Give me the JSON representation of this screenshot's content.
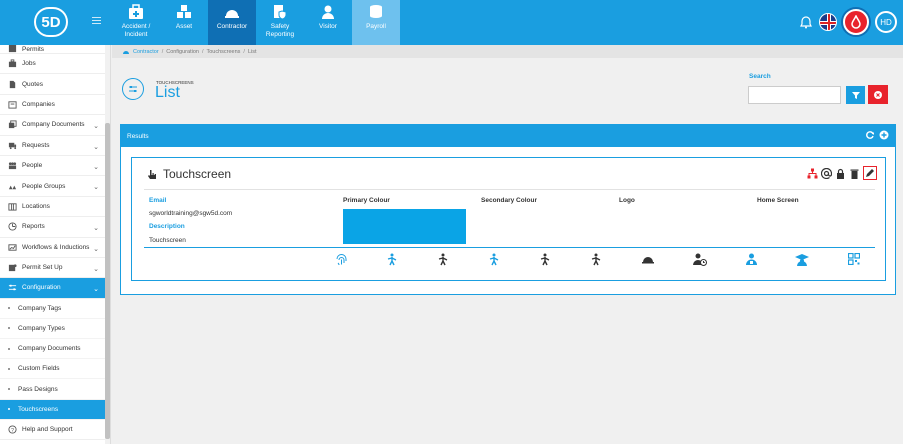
{
  "logo": {
    "text": "5D"
  },
  "modules": [
    {
      "label": "Accident / Incident",
      "icon": "first-aid-kit-icon"
    },
    {
      "label": "Asset",
      "icon": "boxes-icon"
    },
    {
      "label": "Contractor",
      "icon": "hard-hat-icon",
      "active": true
    },
    {
      "label": "Safety Reporting",
      "icon": "shield-clipboard-icon"
    },
    {
      "label": "Visitor",
      "icon": "person-icon"
    },
    {
      "label": "Payroll",
      "icon": "coins-icon"
    }
  ],
  "user": {
    "initials": "HD"
  },
  "sidebar": {
    "top_partial": "Permits",
    "items": [
      {
        "label": "Jobs"
      },
      {
        "label": "Quotes"
      },
      {
        "label": "Companies"
      },
      {
        "label": "Company Documents",
        "chevron": "⌄"
      },
      {
        "label": "Requests",
        "chevron": "⌄"
      },
      {
        "label": "People",
        "chevron": "⌄"
      },
      {
        "label": "People Groups",
        "chevron": "⌄"
      },
      {
        "label": "Locations"
      },
      {
        "label": "Reports",
        "chevron": "⌄"
      },
      {
        "label": "Workflows & Inductions",
        "chevron": "⌄"
      },
      {
        "label": "Permit Set Up",
        "chevron": "⌄"
      },
      {
        "label": "Configuration",
        "chevron": "⌄"
      }
    ],
    "subitems": [
      {
        "label": "Company Tags"
      },
      {
        "label": "Company Types"
      },
      {
        "label": "Company Documents"
      },
      {
        "label": "Custom Fields"
      },
      {
        "label": "Pass Designs"
      },
      {
        "label": "Touchscreens"
      }
    ],
    "help": "Help and Support"
  },
  "breadcrumb": [
    "Contractor",
    "Configuration",
    "Touchscreens",
    "List"
  ],
  "header": {
    "supertitle": "TOUCHSCREENS",
    "title": "List"
  },
  "search": {
    "label": "Search",
    "value": "",
    "placeholder": ""
  },
  "results": {
    "title": "Results"
  },
  "card": {
    "title": "Touchscreen",
    "email_label": "Email",
    "email": "sgworldtraining@sgw5d.com",
    "description_label": "Description",
    "description": "Touchscreen",
    "primary_label": "Primary Colour",
    "primary_color": "#0aa4e6",
    "secondary_label": "Secondary Colour",
    "logo_label": "Logo",
    "home_label": "Home Screen",
    "feature_icons": [
      "fingerprint-icon",
      "walk-in-icon",
      "walk-out-icon",
      "walk-in-icon-2",
      "walk-out-icon-2",
      "walk-icon-3",
      "hard-hat-icon",
      "person-clock-icon",
      "person-badge-icon",
      "graduation-icon",
      "qr-code-icon"
    ]
  },
  "colors": {
    "accent": "#1a9ee0",
    "dark_accent": "#0f6fb4",
    "danger": "#e8232c"
  }
}
